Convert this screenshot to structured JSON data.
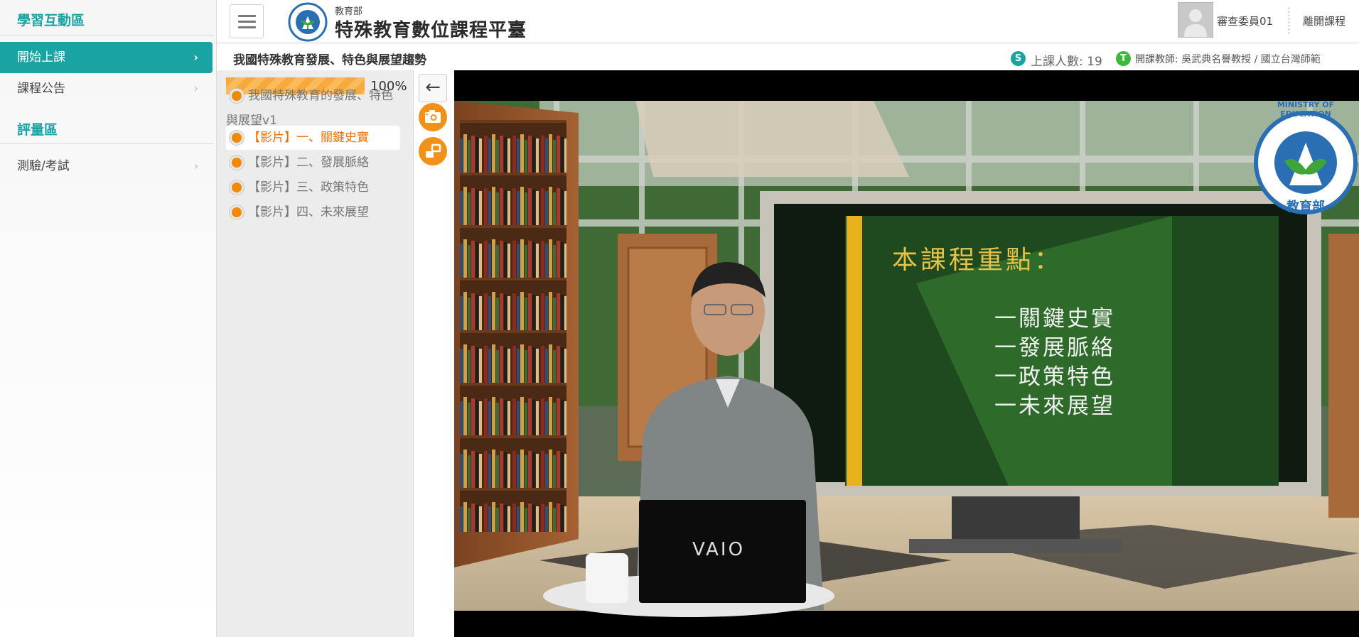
{
  "sidebar": {
    "section1_title": "學習互動區",
    "items": [
      {
        "label": "開始上課",
        "chevron": "›"
      },
      {
        "label": "課程公告",
        "chevron": "›"
      }
    ],
    "section2_title": "評量區",
    "items2": [
      {
        "label": "測驗/考試",
        "chevron": "›"
      }
    ]
  },
  "header": {
    "brand_small": "教育部",
    "brand_big": "特殊教育數位課程平臺",
    "user_name": "審查委員01",
    "leave_label": "離開課程"
  },
  "subheader": {
    "course_title": "我國特殊教育發展、特色與展望趨勢",
    "student_badge": "S",
    "student_count": "上課人數: 19",
    "teacher_badge": "T",
    "teacher_info": "開課教師: 吳武典名譽教授 / 國立台灣師範"
  },
  "progress": {
    "fraction": 1.0,
    "text": "100%"
  },
  "chapters": [
    {
      "title": "我國特殊教育的發展、特色與展望v1",
      "active": false
    },
    {
      "title": "【影片】一、關鍵史實",
      "active": true
    },
    {
      "title": "【影片】二、發展脈絡",
      "active": false
    },
    {
      "title": "【影片】三、政策特色",
      "active": false
    },
    {
      "title": "【影片】四、未來展望",
      "active": false
    }
  ],
  "tools": {
    "back_icon": "←",
    "camera_icon": "camera-icon",
    "popout_icon": "popout-icon"
  },
  "video": {
    "board_title": "本課程重點：",
    "board_items": [
      "一關鍵史實",
      "一發展脈絡",
      "一政策特色",
      "一未來展望"
    ],
    "emblem_text": "MINISTRY OF EDUCATION",
    "emblem_bottom": "教育部",
    "laptop_brand": "VAIO"
  },
  "colors": {
    "accent": "#1aa3a3",
    "orange": "#f29018",
    "active_chapter": "#f06f00"
  }
}
